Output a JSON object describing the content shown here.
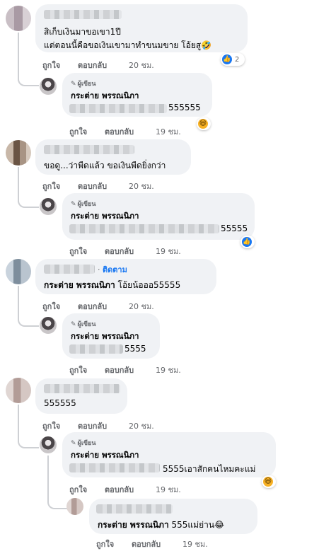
{
  "actions": {
    "like": "ถูกใจ",
    "reply": "ตอบกลับ"
  },
  "author_label": "ผู้เขียน",
  "follow_label": "ติดตาม",
  "comments": [
    {
      "line1": "สิเก็บเงินมาขอเขา1ปี",
      "line2": "แต่ตอนนี้คือขอเงินเขามาทำขนมขาย โอ้ยสู",
      "emoji": "🤣",
      "time": "20 ชม.",
      "reaction_count": "2",
      "reply": {
        "name": "กระต่าย พรรณนิภา",
        "text": "555555",
        "time": "19 ชม."
      }
    },
    {
      "line1": "ขอดู...ว่าพืดแล้ว ขอเงินพืดยิ่งกว่า",
      "time": "20 ชม.",
      "reply": {
        "name": "กระต่าย พรรณนิภา",
        "text": "55555",
        "time": "19 ชม."
      }
    },
    {
      "name": "กระต่าย พรรณนิภา",
      "text": "โอ้ยน้อออ55555",
      "time": "20 ชม.",
      "reply": {
        "name": "กระต่าย พรรณนิภา",
        "text": "5555",
        "time": "19 ชม."
      }
    },
    {
      "line1": "555555",
      "time": "20 ชม.",
      "reply": {
        "name": "กระต่าย พรรณนิภา",
        "text": "5555เอาสักคนไหมคะแม่",
        "time": "19 ชม."
      },
      "reply2": {
        "name": "กระต่าย พรรณนิภา",
        "text": "555แม่ย่าน",
        "emoji": "😂",
        "time": "19 ชม."
      }
    }
  ]
}
